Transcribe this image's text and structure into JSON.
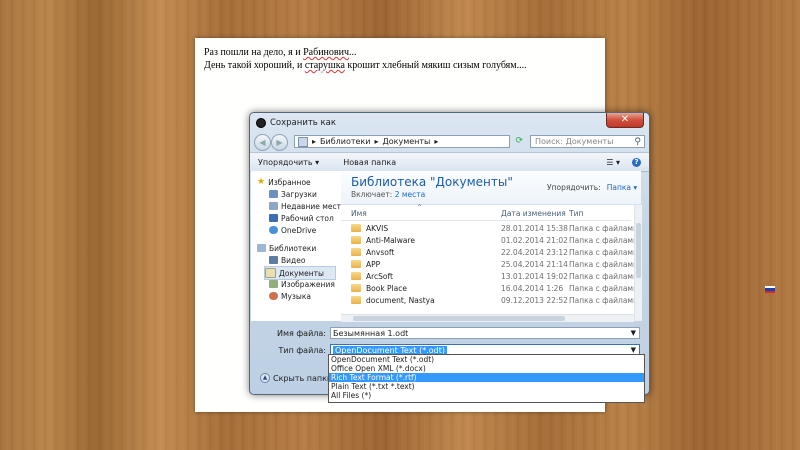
{
  "document": {
    "line1_prefix": "Раз пошли на дело, я и ",
    "line1_name": "Рабинович",
    "line1_suffix": "...",
    "line2_prefix": "День такой хороший, и ",
    "line2_word": "старушка",
    "line2_suffix": " крошит хлебный мякиш сизым голубям...."
  },
  "dialog": {
    "title": "Сохранить как",
    "close_glyph": "✕",
    "address": {
      "separator": "▸",
      "segments": [
        "Библиотеки",
        "Документы"
      ]
    },
    "search_placeholder": "Поиск: Документы",
    "toolbar": {
      "organize": "Упорядочить ▾",
      "new_folder": "Новая папка"
    },
    "sidebar": [
      {
        "label": "Избранное",
        "icon": "star-icon",
        "sub": false
      },
      {
        "label": "Загрузки",
        "icon": "downloads-icon",
        "sub": true
      },
      {
        "label": "Недавние места",
        "icon": "recent-places-icon",
        "sub": true
      },
      {
        "label": "Рабочий стол",
        "icon": "desktop-icon",
        "sub": true
      },
      {
        "label": "OneDrive",
        "icon": "onedrive-icon",
        "sub": true
      },
      {
        "label": "Библиотеки",
        "icon": "libraries-icon",
        "sub": false
      },
      {
        "label": "Видео",
        "icon": "video-icon",
        "sub": true
      },
      {
        "label": "Документы",
        "icon": "documents-icon",
        "sub": true,
        "selected": true
      },
      {
        "label": "Изображения",
        "icon": "pictures-icon",
        "sub": true
      },
      {
        "label": "Музыка",
        "icon": "music-icon",
        "sub": true
      }
    ],
    "library": {
      "title": "Библиотека \"Документы\"",
      "includes_label": "Включает:",
      "includes_link": "2 места",
      "arrange_label": "Упорядочить:",
      "arrange_value": "Папка ▾"
    },
    "columns": {
      "name": "Имя",
      "date": "Дата изменения",
      "type": "Тип"
    },
    "rows": [
      {
        "name": "AKVIS",
        "date": "28.01.2014 15:38",
        "type": "Папка с файлами"
      },
      {
        "name": "Anti-Malware",
        "date": "01.02.2014 21:02",
        "type": "Папка с файлами"
      },
      {
        "name": "Anvsoft",
        "date": "22.04.2014 23:12",
        "type": "Папка с файлами"
      },
      {
        "name": "APP",
        "date": "25.04.2014 21:14",
        "type": "Папка с файлами"
      },
      {
        "name": "ArcSoft",
        "date": "13.01.2014 19:02",
        "type": "Папка с файлами"
      },
      {
        "name": "Book Place",
        "date": "16.04.2014 1:26",
        "type": "Папка с файлами"
      },
      {
        "name": "document, Nastya",
        "date": "09.12.2013 22:52",
        "type": "Папка с файлами"
      }
    ],
    "form": {
      "filename_label": "Имя файла:",
      "filename_value": "Безымянная 1.odt",
      "filetype_label": "Тип файла:",
      "filetype_value": "OpenDocument Text (*.odt)",
      "hide_folders": "Скрыть папки"
    },
    "filetype_options": [
      "OpenDocument Text (*.odt)",
      "Office Open XML (*.docx)",
      "Rich Text Format (*.rtf)",
      "Plain Text (*.txt *.text)",
      "All Files (*)"
    ],
    "highlighted_option_index": 2
  },
  "tray": {
    "language_flag": "russian-flag-icon"
  },
  "colors": {
    "accent": "#3399ff",
    "title_blue": "#1e5ca8",
    "flag": [
      "#ffffff",
      "#1c3fb0",
      "#d52b1e"
    ]
  }
}
